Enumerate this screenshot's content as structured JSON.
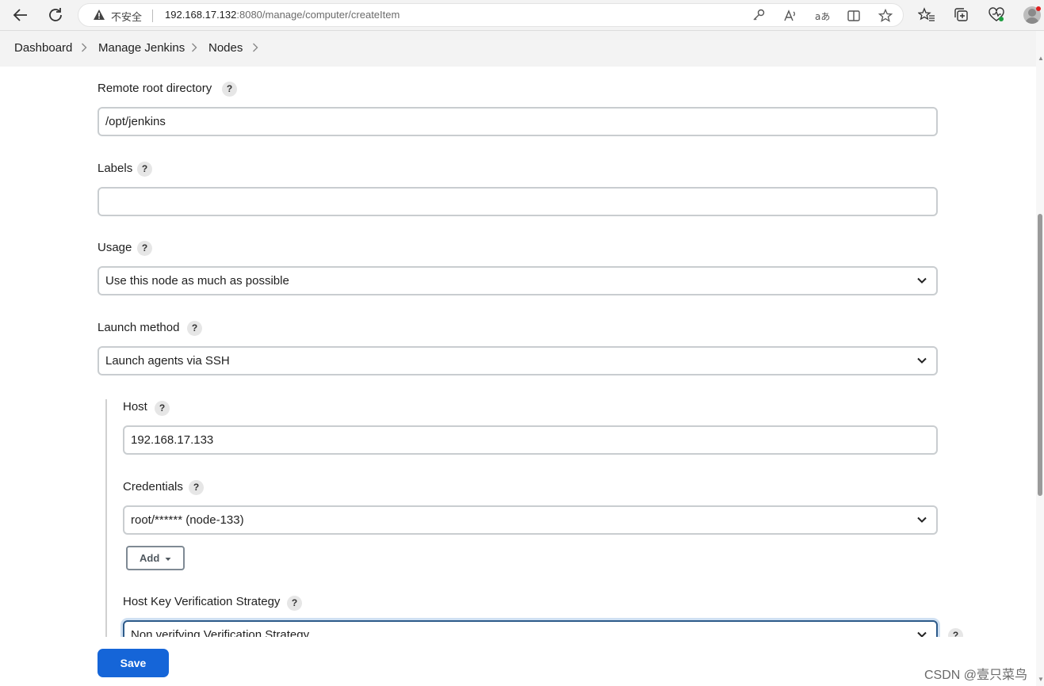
{
  "browser": {
    "security_label": "不安全",
    "url_host": "192.168.17.132",
    "url_rest": ":8080/manage/computer/createItem"
  },
  "breadcrumb": [
    "Dashboard",
    "Manage Jenkins",
    "Nodes"
  ],
  "form": {
    "remote_root": {
      "label": "Remote root directory",
      "help": "?",
      "value": "/opt/jenkins"
    },
    "labels": {
      "label": "Labels",
      "help": "?",
      "value": ""
    },
    "usage": {
      "label": "Usage",
      "help": "?",
      "selected": "Use this node as much as possible"
    },
    "launch_method": {
      "label": "Launch method",
      "help": "?",
      "selected": "Launch agents via SSH"
    },
    "host": {
      "label": "Host",
      "help": "?",
      "value": "192.168.17.133"
    },
    "credentials": {
      "label": "Credentials",
      "help": "?",
      "selected": "root/****** (node-133)",
      "add_label": "Add"
    },
    "host_key": {
      "label": "Host Key Verification Strategy",
      "help": "?",
      "selected": "Non verifying Verification Strategy",
      "side_help": "?"
    }
  },
  "save_label": "Save",
  "watermark": "CSDN @壹只菜鸟"
}
